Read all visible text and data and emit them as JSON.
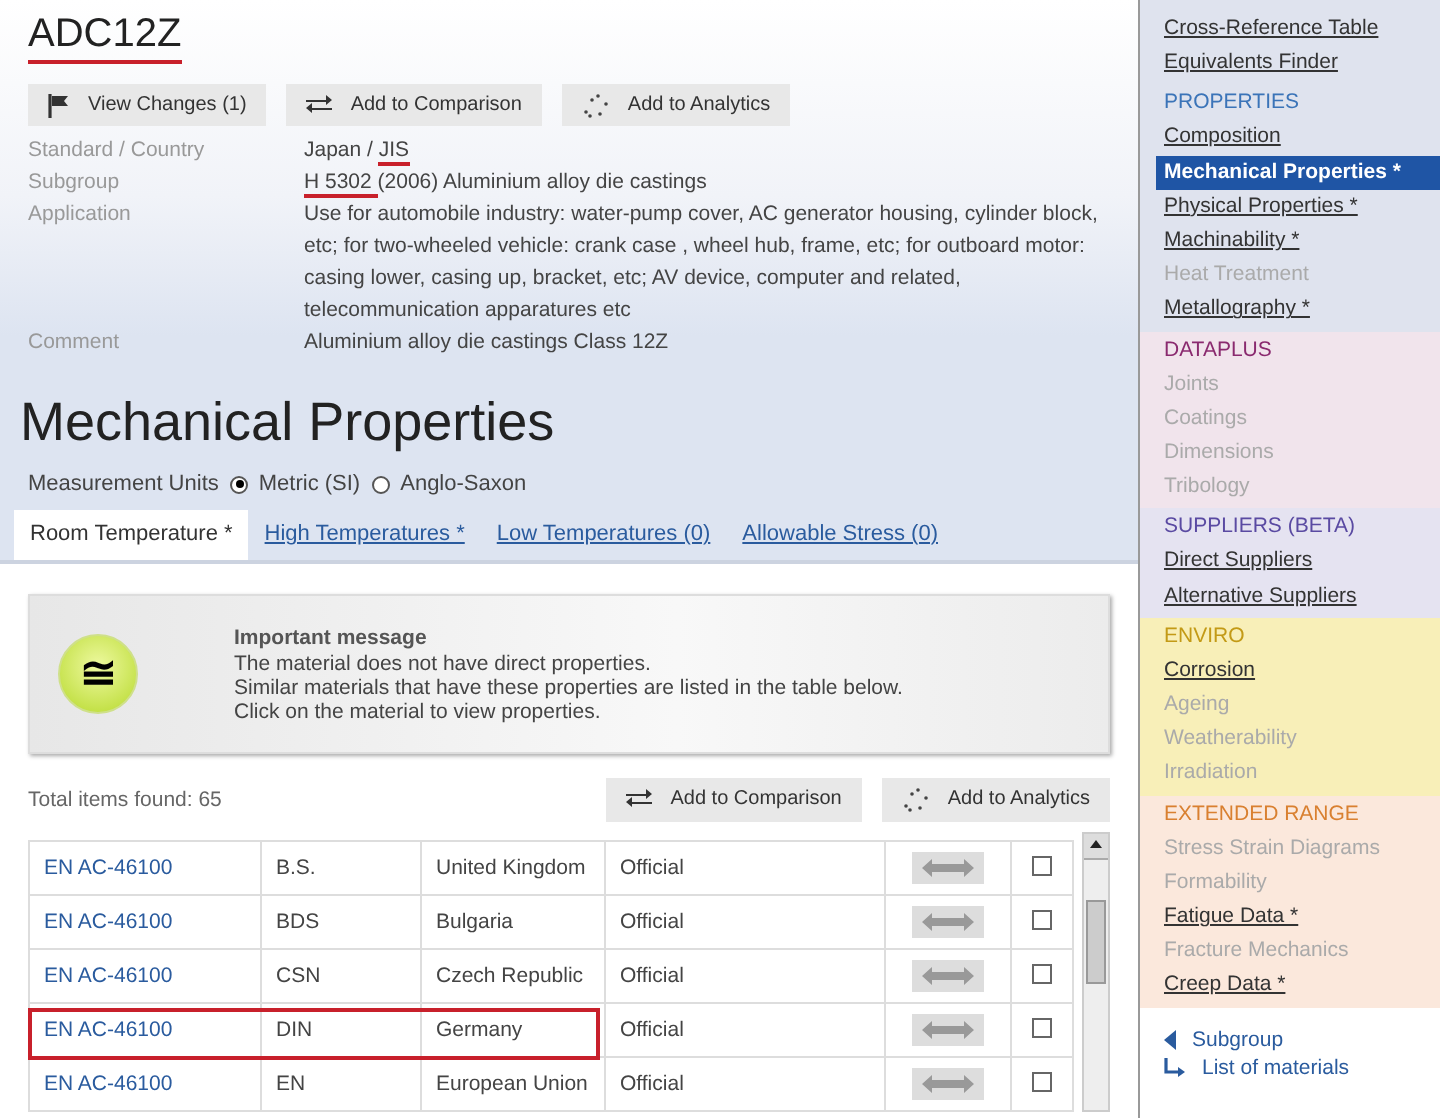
{
  "material": {
    "title": "ADC12Z",
    "title_marked": true,
    "actions": [
      {
        "kind": "flag",
        "label": "View Changes (1)"
      },
      {
        "kind": "compare",
        "label": "Add to Comparison"
      },
      {
        "kind": "analytics",
        "label": "Add to Analytics"
      }
    ],
    "details": [
      {
        "label": "Standard / Country",
        "parts": [
          {
            "text": "Japan / ",
            "link": false,
            "marked": false
          },
          {
            "text": "JIS",
            "link": true,
            "marked": true
          }
        ]
      },
      {
        "label": "Subgroup",
        "parts": [
          {
            "text": "H 5302 ",
            "link": true,
            "marked": true
          },
          {
            "text": "(2006) Aluminium alloy die castings",
            "link": false,
            "marked": false
          }
        ]
      },
      {
        "label": "Application",
        "parts": [
          {
            "text": "Use for automobile industry: water-pump cover, AC generator housing, cylinder block, etc; for two-wheeled vehicle: crank case , wheel hub, frame, etc; for outboard motor: casing lower, casing up, bracket, etc; AV device, computer and related, telecommunication apparatures etc",
            "link": false,
            "marked": false
          }
        ]
      },
      {
        "label": "Comment",
        "parts": [
          {
            "text": "Aluminium alloy die castings Class 12Z",
            "link": false,
            "marked": false
          }
        ]
      }
    ]
  },
  "heading": "Mechanical Properties",
  "units": {
    "label": "Measurement Units",
    "options": [
      {
        "label": "Metric (SI)",
        "selected": true
      },
      {
        "label": "Anglo-Saxon",
        "selected": false
      }
    ]
  },
  "tabs": [
    {
      "label": "Room Temperature *",
      "selected": true
    },
    {
      "label": "High Temperatures *",
      "selected": false
    },
    {
      "label": "Low Temperatures (0)",
      "selected": false
    },
    {
      "label": "Allowable Stress (0)",
      "selected": false
    }
  ],
  "message": {
    "icon": "≅",
    "title": "Important message",
    "lines": [
      "The material does not have direct properties.",
      "Similar materials that have these properties are listed in the table below.",
      "Click on the material to view properties."
    ]
  },
  "results": {
    "total": "Total items found: 65",
    "actions": [
      {
        "kind": "compare",
        "label": "Add to Comparison"
      },
      {
        "kind": "analytics",
        "label": "Add to Analytics"
      }
    ],
    "rows": [
      {
        "material": "EN AC-46100",
        "standard": "B.S.",
        "country": "United Kingdom",
        "status": "Official",
        "checked": false,
        "marked": false
      },
      {
        "material": "EN AC-46100",
        "standard": "BDS",
        "country": "Bulgaria",
        "status": "Official",
        "checked": false,
        "marked": false
      },
      {
        "material": "EN AC-46100",
        "standard": "CSN",
        "country": "Czech Republic",
        "status": "Official",
        "checked": false,
        "marked": false
      },
      {
        "material": "EN AC-46100",
        "standard": "DIN",
        "country": "Germany",
        "status": "Official",
        "checked": false,
        "marked": true
      },
      {
        "material": "EN AC-46100",
        "standard": "EN",
        "country": "European Union",
        "status": "Official",
        "checked": false,
        "marked": false
      }
    ]
  },
  "sidebar": {
    "sections": [
      {
        "kind": "cross",
        "items": [
          {
            "label": "Cross-Reference Table",
            "available": true,
            "selected": false
          },
          {
            "label": "Equivalents Finder",
            "available": true,
            "selected": false
          }
        ]
      },
      {
        "kind": "properties",
        "title": "PROPERTIES",
        "items": [
          {
            "label": "Composition",
            "available": true,
            "selected": false
          },
          {
            "label": "Mechanical Properties *",
            "available": true,
            "selected": true
          },
          {
            "label": "Physical Properties *",
            "available": true,
            "selected": false
          },
          {
            "label": "Machinability *",
            "available": true,
            "selected": false
          },
          {
            "label": "Heat Treatment",
            "available": false,
            "selected": false
          },
          {
            "label": "Metallography *",
            "available": true,
            "selected": false
          }
        ]
      },
      {
        "kind": "dataplus",
        "title": "DATAPLUS",
        "items": [
          {
            "label": "Joints",
            "available": false,
            "selected": false
          },
          {
            "label": "Coatings",
            "available": false,
            "selected": false
          },
          {
            "label": "Dimensions",
            "available": false,
            "selected": false
          },
          {
            "label": "Tribology",
            "available": false,
            "selected": false
          }
        ]
      },
      {
        "kind": "suppliers",
        "title": "SUPPLIERS (BETA)",
        "items": [
          {
            "label": "Direct Suppliers",
            "available": true,
            "selected": false
          },
          {
            "label": "Alternative Suppliers",
            "available": true,
            "selected": false
          }
        ]
      },
      {
        "kind": "enviro",
        "title": "ENVIRO",
        "items": [
          {
            "label": "Corrosion",
            "available": true,
            "selected": false
          },
          {
            "label": "Ageing",
            "available": false,
            "selected": false
          },
          {
            "label": "Weatherability",
            "available": false,
            "selected": false
          },
          {
            "label": "Irradiation",
            "available": false,
            "selected": false
          }
        ]
      },
      {
        "kind": "extended",
        "title": "EXTENDED RANGE",
        "items": [
          {
            "label": "Stress Strain Diagrams",
            "available": false,
            "selected": false
          },
          {
            "label": "Formability",
            "available": false,
            "selected": false
          },
          {
            "label": "Fatigue Data *",
            "available": true,
            "selected": false
          },
          {
            "label": "Fracture Mechanics",
            "available": false,
            "selected": false
          },
          {
            "label": "Creep Data *",
            "available": true,
            "selected": false
          }
        ]
      }
    ],
    "nav": [
      {
        "kind": "back",
        "label": "Subgroup"
      },
      {
        "kind": "list",
        "label": "List of materials"
      }
    ]
  }
}
